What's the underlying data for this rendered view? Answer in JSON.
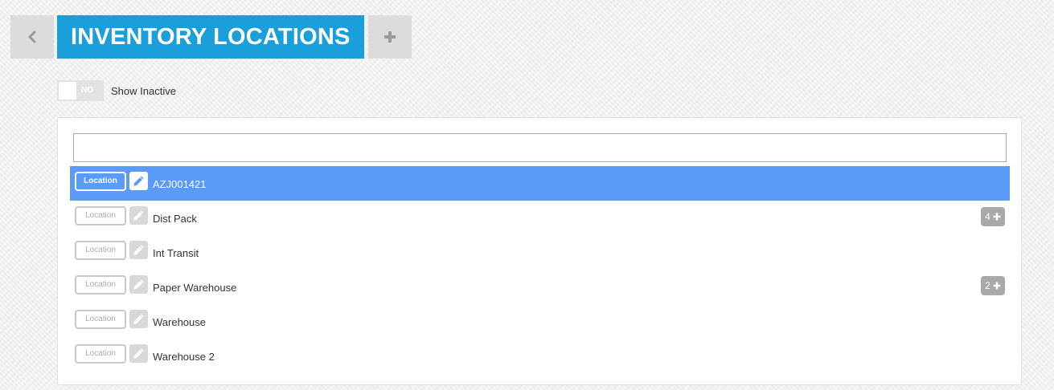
{
  "header": {
    "title": "INVENTORY LOCATIONS",
    "back_icon": "chevron-left-icon",
    "add_icon": "plus-icon"
  },
  "toggle": {
    "state_label": "NO",
    "label": "Show Inactive"
  },
  "search": {
    "value": "",
    "placeholder": ""
  },
  "locations": [
    {
      "type_label": "Location",
      "name": "AZJ001421",
      "count": "",
      "selected": true
    },
    {
      "type_label": "Location",
      "name": "Dist Pack",
      "count": "4",
      "selected": false
    },
    {
      "type_label": "Location",
      "name": "Int Transit",
      "count": "",
      "selected": false
    },
    {
      "type_label": "Location",
      "name": "Paper Warehouse",
      "count": "2",
      "selected": false
    },
    {
      "type_label": "Location",
      "name": "Warehouse",
      "count": "",
      "selected": false
    },
    {
      "type_label": "Location",
      "name": "Warehouse 2",
      "count": "",
      "selected": false
    }
  ],
  "colors": {
    "title_bg": "#1a9fdb",
    "selected_row": "#5a9bfa",
    "badge": "#a9a9a9"
  }
}
